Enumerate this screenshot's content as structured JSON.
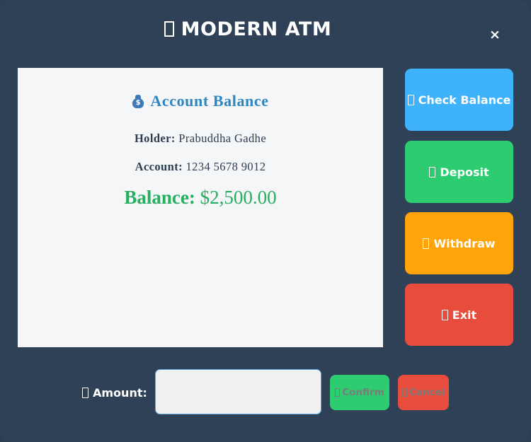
{
  "window": {
    "title": "MODERN ATM",
    "title_icon": "missing-glyph-box",
    "close_label": "×"
  },
  "panel": {
    "heading": "Account Balance",
    "heading_icon": "money-bag-icon",
    "holder_label": "Holder:",
    "holder_value": "Prabuddha Gadhe",
    "account_label": "Account:",
    "account_value": "1234 5678 9012",
    "balance_label": "Balance:",
    "balance_value": "$2,500.00"
  },
  "actions": [
    {
      "label": "Check Balance",
      "color": "#3eb3fc"
    },
    {
      "label": "Deposit",
      "color": "#2ecc71"
    },
    {
      "label": "Withdraw",
      "color": "#ffa40a"
    },
    {
      "label": "Exit",
      "color": "#e84c3d"
    }
  ],
  "amount": {
    "label": "Amount:",
    "value": "",
    "confirm_label": "Confirm",
    "cancel_label": "Cancel"
  },
  "colors": {
    "background": "#2f4156",
    "panel": "#f4f6f7",
    "heading": "#2e86c1",
    "balance": "#27ae60"
  }
}
